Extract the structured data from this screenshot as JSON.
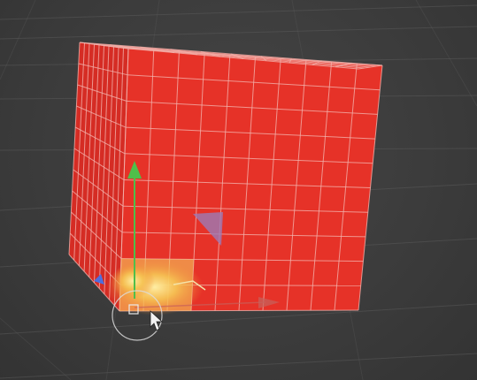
{
  "viewport": {
    "background_color": "#3b3b3b",
    "grid_color": "#5a5a5a"
  },
  "object": {
    "name_icon": "cube-mesh",
    "face_color": "#e63228",
    "top_face_color": "#b8423e",
    "side_face_color": "#d52c24",
    "wire_color": "#f2b0aa",
    "grid_divisions": 10
  },
  "selection": {
    "highlight_color": "#f6d560",
    "selected_faces": 3
  },
  "gizmo": {
    "icon": "transform-gizmo",
    "y_axis_color": "#4fbf4a",
    "z_axis_color": "#4c6fe0",
    "x_axis_color": "#c7605a",
    "plane_handle_color": "#9c7ab5"
  },
  "cursor": {
    "icon": "mouse-pointer-icon"
  }
}
